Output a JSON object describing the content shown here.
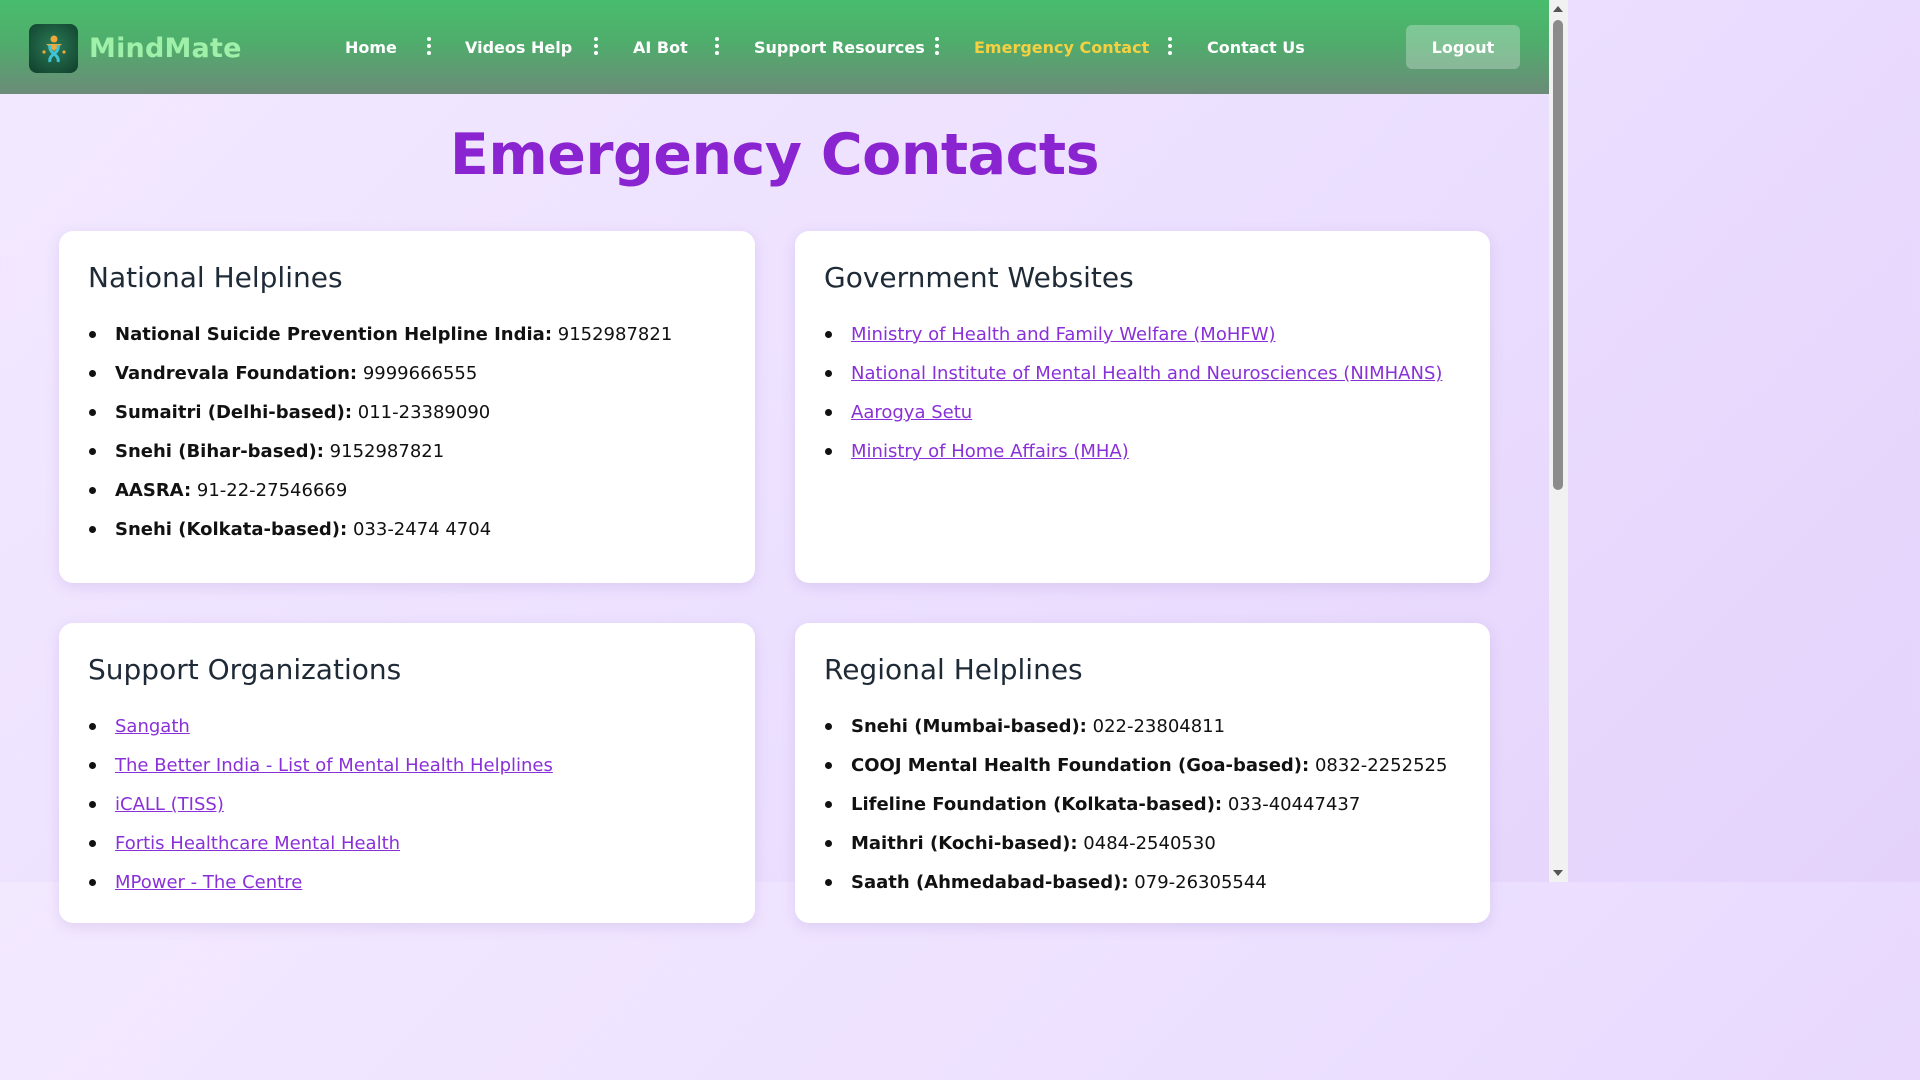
{
  "brand": {
    "name": "MindMate",
    "icon": "ribbon-person-icon"
  },
  "nav": {
    "items": [
      {
        "label": "Home",
        "active": false
      },
      {
        "label": "Videos Help",
        "active": false
      },
      {
        "label": "AI Bot",
        "active": false
      },
      {
        "label": "Support Resources",
        "active": false
      },
      {
        "label": "Emergency Contact",
        "active": true
      },
      {
        "label": "Contact Us",
        "active": false
      }
    ],
    "logout_label": "Logout"
  },
  "page": {
    "title": "Emergency Contacts"
  },
  "cards": {
    "national": {
      "title": "National Helplines",
      "items": [
        {
          "name": "National Suicide Prevention Helpline India:",
          "value": " 9152987821"
        },
        {
          "name": "Vandrevala Foundation:",
          "value": " 9999666555"
        },
        {
          "name": "Sumaitri (Delhi-based):",
          "value": " 011-23389090"
        },
        {
          "name": "Snehi (Bihar-based):",
          "value": " 9152987821"
        },
        {
          "name": "AASRA:",
          "value": " 91-22-27546669"
        },
        {
          "name": "Snehi (Kolkata-based):",
          "value": " 033-2474 4704"
        }
      ]
    },
    "government": {
      "title": "Government Websites",
      "links": [
        "Ministry of Health and Family Welfare (MoHFW)",
        "National Institute of Mental Health and Neurosciences (NIMHANS)",
        "Aarogya Setu",
        "Ministry of Home Affairs (MHA)"
      ]
    },
    "support": {
      "title": "Support Organizations",
      "links": [
        "Sangath",
        "The Better India - List of Mental Health Helplines",
        "iCALL (TISS)",
        "Fortis Healthcare Mental Health",
        "MPower - The Centre"
      ]
    },
    "regional": {
      "title": "Regional Helplines",
      "items": [
        {
          "name": "Snehi (Mumbai-based):",
          "value": " 022-23804811"
        },
        {
          "name": "COOJ Mental Health Foundation (Goa-based):",
          "value": " 0832-2252525"
        },
        {
          "name": "Lifeline Foundation (Kolkata-based):",
          "value": " 033-40447437"
        },
        {
          "name": "Maithri (Kochi-based):",
          "value": " 0484-2540530"
        },
        {
          "name": "Saath (Ahmedabad-based):",
          "value": " 079-26305544"
        }
      ]
    }
  },
  "colors": {
    "brand_green": "#48bd6d",
    "active_nav": "#f5d142",
    "title_purple": "#8a24d1",
    "link_purple": "#8a30d8"
  }
}
